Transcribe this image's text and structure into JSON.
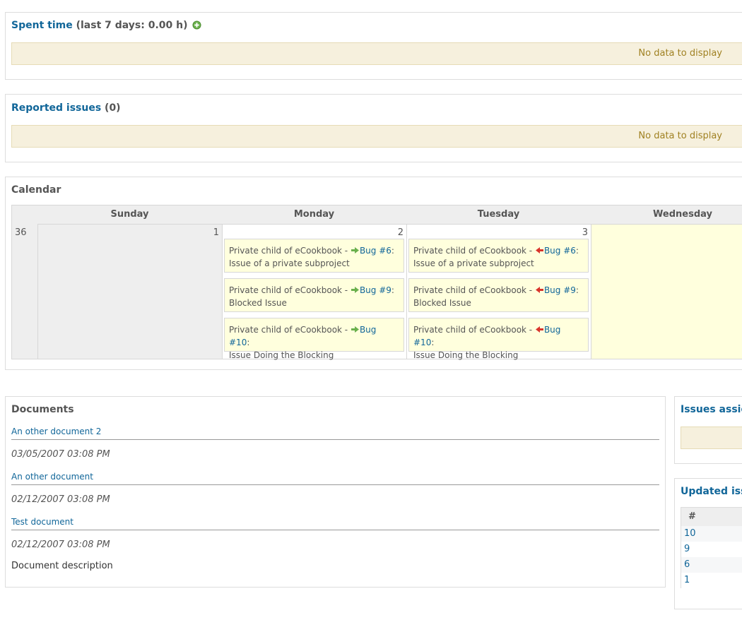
{
  "spent_time": {
    "title_link": "Spent time",
    "title_suffix": "(last 7 days: 0.00 h)",
    "add_icon": "plus-circle-icon",
    "empty_text": "No data to display"
  },
  "reported_issues": {
    "title_link": "Reported issues",
    "title_suffix": "(0)",
    "empty_text": "No data to display"
  },
  "calendar": {
    "title": "Calendar",
    "days": [
      "Sunday",
      "Monday",
      "Tuesday",
      "Wednesday"
    ],
    "week_number": "36",
    "day_numbers": [
      "1",
      "2",
      "3"
    ],
    "monday_issues": [
      {
        "project": "Private child of eCookbook -",
        "arrow": "start-arrow-icon",
        "link": "Bug #6",
        "colon": ":",
        "subject": "Issue of a private subproject"
      },
      {
        "project": "Private child of eCookbook -",
        "arrow": "start-arrow-icon",
        "link": "Bug #9",
        "colon": ":",
        "subject": "Blocked Issue"
      },
      {
        "project": "Private child of eCookbook -",
        "arrow": "start-arrow-icon",
        "link": "Bug #10",
        "colon": ":",
        "subject": "Issue Doing the Blocking"
      }
    ],
    "tuesday_issues": [
      {
        "project": "Private child of eCookbook -",
        "arrow": "end-arrow-icon",
        "link": "Bug #6",
        "colon": ":",
        "subject": "Issue of a private subproject"
      },
      {
        "project": "Private child of eCookbook -",
        "arrow": "end-arrow-icon",
        "link": "Bug #9",
        "colon": ":",
        "subject": "Blocked Issue"
      },
      {
        "project": "Private child of eCookbook -",
        "arrow": "end-arrow-icon",
        "link": "Bug #10",
        "colon": ":",
        "subject": "Issue Doing the Blocking"
      }
    ]
  },
  "documents": {
    "title": "Documents",
    "items": [
      {
        "title": "An other document 2",
        "date": "03/05/2007 03:08 PM"
      },
      {
        "title": "An other document",
        "date": "02/12/2007 03:08 PM"
      },
      {
        "title": "Test document",
        "date": "02/12/2007 03:08 PM",
        "description": "Document description"
      }
    ]
  },
  "issues_assigned": {
    "title_link": "Issues assign"
  },
  "updated_issues": {
    "title_link": "Updated iss",
    "column_header": "#",
    "rows": [
      "10",
      "9",
      "6",
      "1"
    ]
  },
  "colors": {
    "link": "#116699",
    "nodata_bg": "#f6f0dd",
    "today_bg": "#ffffdd",
    "start_arrow": "#6ab04c",
    "end_arrow": "#d9342b"
  }
}
